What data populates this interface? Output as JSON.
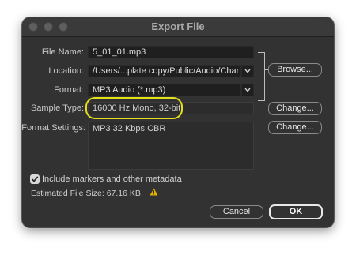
{
  "window": {
    "title": "Export File"
  },
  "form": {
    "file_name_label": "File Name:",
    "file_name_value": "5_01_01.mp3",
    "location_label": "Location:",
    "location_value": "/Users/...plate copy/Public/Audio/Channels",
    "format_label": "Format:",
    "format_value": "MP3 Audio (*.mp3)",
    "sample_type_label": "Sample Type:",
    "sample_type_value": "16000 Hz Mono, 32-bit",
    "format_settings_label": "Format Settings:",
    "format_settings_value": "MP3 32 Kbps CBR"
  },
  "buttons": {
    "browse": "Browse...",
    "change_sample": "Change...",
    "change_format": "Change...",
    "cancel": "Cancel",
    "ok": "OK"
  },
  "options": {
    "include_markers_label": "Include markers and other metadata",
    "include_markers_checked": true
  },
  "status": {
    "estimated_size": "Estimated File Size: 67.16 KB"
  },
  "colors": {
    "highlight": "#e3e01a",
    "warning": "#e5b000"
  },
  "icons": {
    "warning": "warning-icon",
    "checkmark": "checkmark-icon",
    "dropdown": "chevron-down-icon"
  }
}
